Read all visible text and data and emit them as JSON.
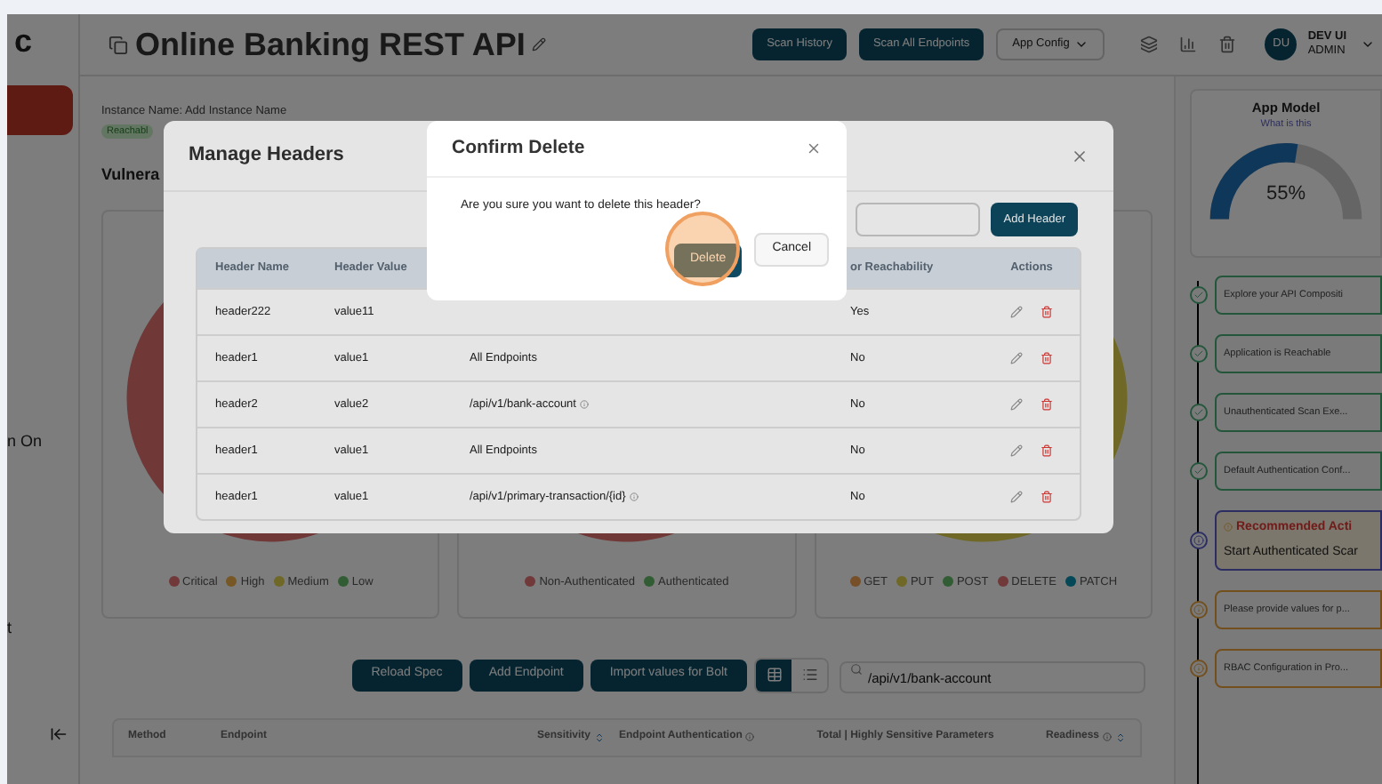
{
  "sidebar": {
    "logo_fragment": "c",
    "items": [
      {
        "label": "n On"
      },
      {
        "label": "t"
      }
    ]
  },
  "header": {
    "title": "Online Banking REST API",
    "buttons": [
      {
        "label": "Scan History",
        "kind": "primary"
      },
      {
        "label": "Scan All Endpoints",
        "kind": "primary"
      },
      {
        "label": "App Config",
        "kind": "dropdown"
      }
    ],
    "user": {
      "initials": "DU",
      "name": "DEV UI",
      "role": "ADMIN"
    }
  },
  "instance": {
    "label": "Instance Name: Add Instance Name",
    "status": "Reachabl",
    "section_title": "Vulnera"
  },
  "charts": [
    {
      "legend": [
        {
          "label": "Critical",
          "color": "#713939"
        },
        {
          "label": "High",
          "color": "#775725"
        },
        {
          "label": "Medium",
          "color": "#706827"
        },
        {
          "label": "Low",
          "color": "#325d34"
        }
      ]
    },
    {
      "legend": [
        {
          "label": "Non-Authenticated",
          "color": "#713939"
        },
        {
          "label": "Authenticated",
          "color": "#325d34"
        }
      ]
    },
    {
      "legend": [
        {
          "label": "GET",
          "color": "#774f28"
        },
        {
          "label": "PUT",
          "color": "#706827"
        },
        {
          "label": "POST",
          "color": "#325d34"
        },
        {
          "label": "DELETE",
          "color": "#713939"
        },
        {
          "label": "PATCH",
          "color": "#044858"
        }
      ]
    }
  ],
  "toolbar": {
    "buttons": [
      "Reload Spec",
      "Add Endpoint",
      "Import values for Bolt"
    ],
    "views": [
      {
        "kind": "table",
        "selected": true
      },
      {
        "kind": "list",
        "selected": false
      }
    ],
    "search": {
      "value": "/api/v1/bank-account"
    }
  },
  "endpoints_table": {
    "columns": [
      {
        "label": "Method"
      },
      {
        "label": "Endpoint"
      },
      {
        "label": "Sensitivity",
        "sortable": true
      },
      {
        "label": "Endpoint Authentication",
        "info": true
      },
      {
        "label": "Total | Highly Sensitive Parameters"
      },
      {
        "label": "Readiness",
        "info": true,
        "sortable": true
      }
    ]
  },
  "app_model": {
    "title": "App Model",
    "link": "What is this",
    "percent": "55%",
    "level": 0.55
  },
  "steps": [
    {
      "kind": "done",
      "label": "Explore your API Compositi"
    },
    {
      "kind": "done",
      "label": "Application is Reachable"
    },
    {
      "kind": "done",
      "label": "Unauthenticated Scan Exe..."
    },
    {
      "kind": "done",
      "label": "Default Authentication Conf..."
    },
    {
      "kind": "recommended",
      "heading": "Recommended Acti",
      "label": "Start Authenticated Scar"
    },
    {
      "kind": "pending",
      "label": "Please provide values for p..."
    },
    {
      "kind": "pending",
      "label": "RBAC Configuration in Pro..."
    }
  ],
  "manage_headers": {
    "title": "Manage Headers",
    "add_button": "Add Header",
    "columns": [
      {
        "label": "Header Name"
      },
      {
        "label": "Header Value"
      },
      {},
      {
        "label": "or Reachability"
      },
      {
        "label": "Actions"
      }
    ],
    "rows": [
      {
        "name": "header222",
        "value": "value11",
        "reachability": "Yes"
      },
      {
        "name": "header1",
        "value": "value1",
        "scope": "All Endpoints",
        "scope_info": false,
        "reachability": "No"
      },
      {
        "name": "header2",
        "value": "value2",
        "scope": "/api/v1/bank-account",
        "scope_info": true,
        "reachability": "No"
      },
      {
        "name": "header1",
        "value": "value1",
        "scope": "All Endpoints",
        "scope_info": false,
        "reachability": "No"
      },
      {
        "name": "header1",
        "value": "value1",
        "scope": "/api/v1/primary-transaction/{id}",
        "scope_info": true,
        "reachability": "No"
      }
    ]
  },
  "confirm_dialog": {
    "title": "Confirm Delete",
    "message": "Are you sure you want to delete this header?",
    "confirm": "Delete",
    "cancel": "Cancel",
    "highlighted": true
  }
}
